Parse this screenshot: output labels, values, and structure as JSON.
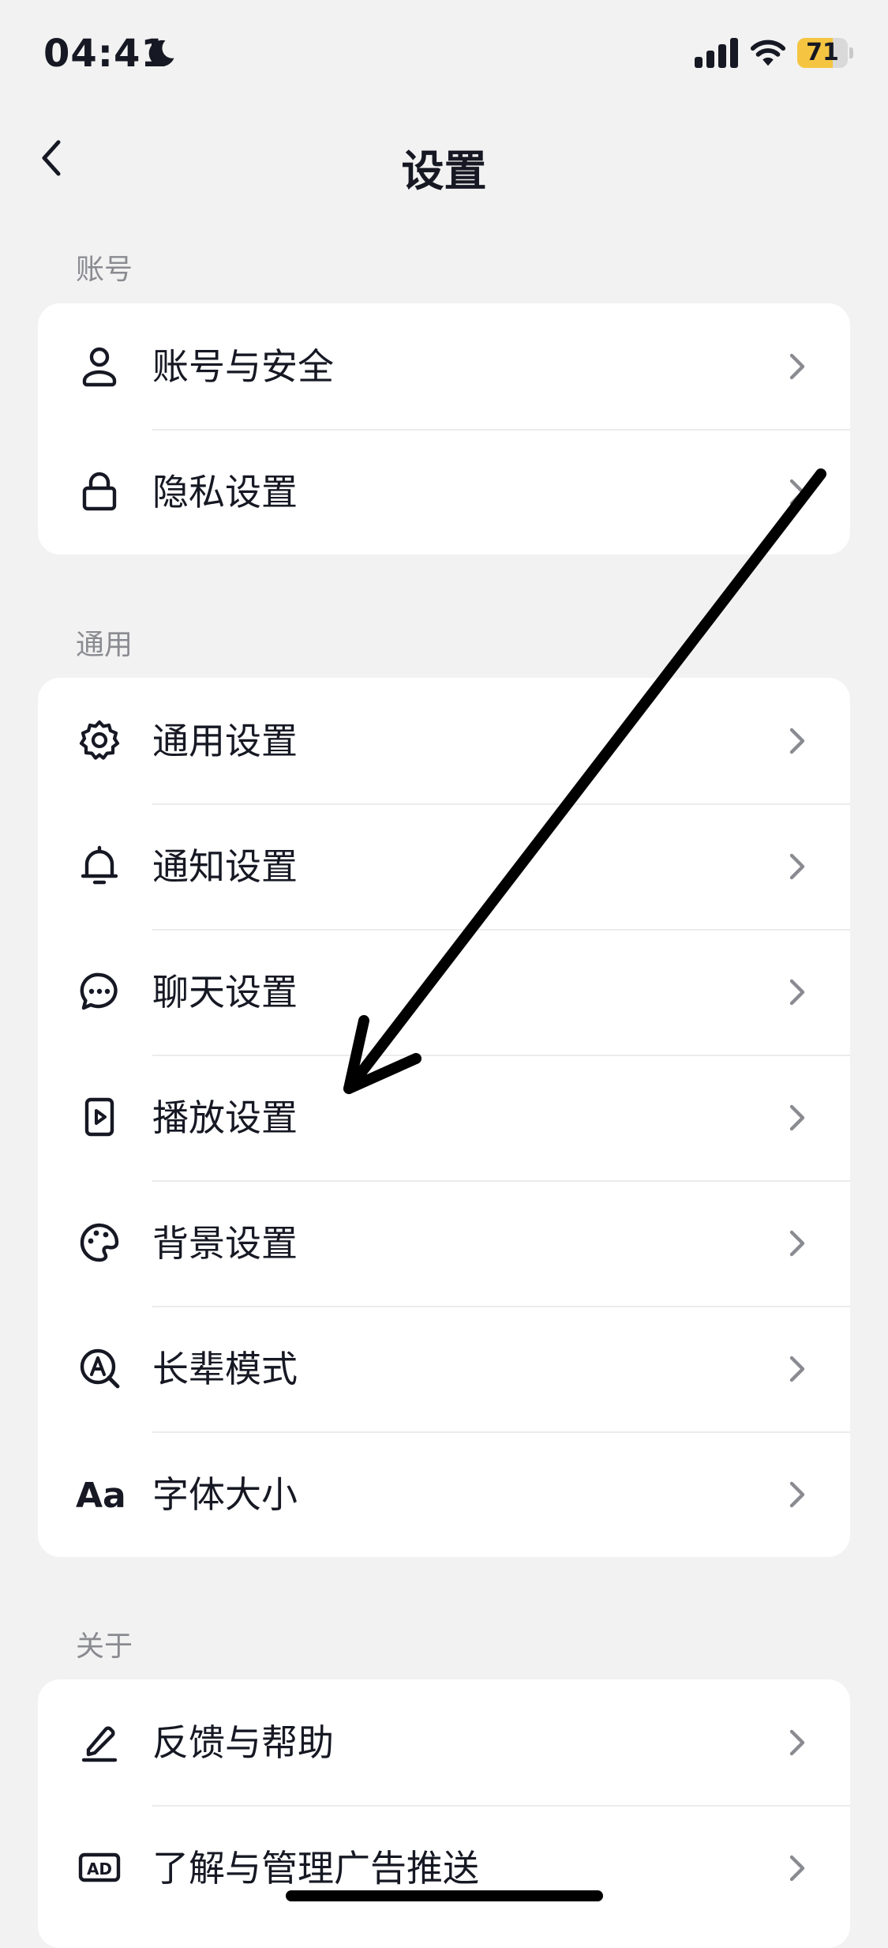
{
  "status_bar": {
    "time": "04:41",
    "battery": "71",
    "battery_level": 0.71
  },
  "nav": {
    "title": "设置"
  },
  "sections": [
    {
      "title": "账号",
      "items": [
        {
          "label": "账号与安全",
          "icon": "user-icon"
        },
        {
          "label": "隐私设置",
          "icon": "lock-icon"
        }
      ]
    },
    {
      "title": "通用",
      "items": [
        {
          "label": "通用设置",
          "icon": "gear-icon"
        },
        {
          "label": "通知设置",
          "icon": "bell-icon"
        },
        {
          "label": "聊天设置",
          "icon": "chat-bubble-icon"
        },
        {
          "label": "播放设置",
          "icon": "play-icon"
        },
        {
          "label": "背景设置",
          "icon": "palette-icon"
        },
        {
          "label": "长辈模式",
          "icon": "elder-mode-icon"
        },
        {
          "label": "字体大小",
          "icon": "font-size-icon",
          "icon_text": "Aa"
        }
      ]
    },
    {
      "title": "关于",
      "items": [
        {
          "label": "反馈与帮助",
          "icon": "pencil-icon"
        },
        {
          "label": "了解与管理广告推送",
          "icon": "ad-icon",
          "icon_text": "AD"
        }
      ]
    }
  ],
  "colors": {
    "background": "#f2f2f2",
    "card": "#ffffff",
    "text": "#161823",
    "section_title": "#8a8b91",
    "battery": "#f5c542"
  }
}
